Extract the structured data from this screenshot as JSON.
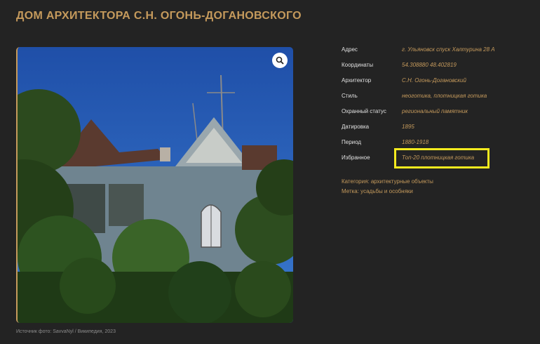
{
  "page": {
    "title": "ДОМ АРХИТЕКТОРА С.Н. ОГОНЬ-ДОГАНОВСКОГО"
  },
  "photo": {
    "caption": "Источник фото: SavvaNyl / Википедия, 2023",
    "zoom_icon": "magnifier-icon"
  },
  "properties": [
    {
      "key": "Адрес",
      "value": "г. Ульяновск спуск Халтурина 28 А"
    },
    {
      "key": "Координаты",
      "value": "54.308880 48.402819"
    },
    {
      "key": "Архитектор",
      "value": "С.Н. Огонь-Догановский"
    },
    {
      "key": "Стиль",
      "value": "неоготика, плотницкая готика"
    },
    {
      "key": "Охранный статус",
      "value": "региональный памятник"
    },
    {
      "key": "Датировка",
      "value": "1895"
    },
    {
      "key": "Период",
      "value": "1880-1918"
    },
    {
      "key": "Избранное",
      "value": "Топ-20 плотницкая готика"
    }
  ],
  "meta": {
    "category": "Категория: архитектурные объекты",
    "tag": "Метка: усадьбы и особняки"
  },
  "colors": {
    "accent": "#c59a5c",
    "background": "#232323",
    "highlight": "#f3ea1e"
  }
}
